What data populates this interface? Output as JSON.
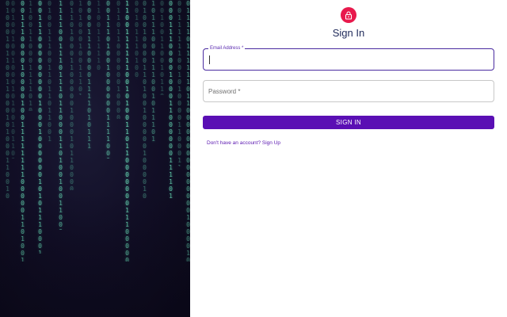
{
  "header": {
    "title": "Sign In",
    "avatar_icon": "lock-icon",
    "avatar_color": "#e8194c"
  },
  "form": {
    "email": {
      "label": "Email Address *",
      "value": "",
      "focused": true
    },
    "password": {
      "placeholder": "Password *",
      "value": ""
    },
    "submit_label": "SIGN IN",
    "signup_link": "Don't have an account? Sign Up"
  },
  "colors": {
    "primary": "#5a0fb4",
    "focus_border": "#4a2ba0",
    "title_text": "#1f2a5a"
  },
  "decoration": {
    "background": "matrix-binary-rain"
  }
}
